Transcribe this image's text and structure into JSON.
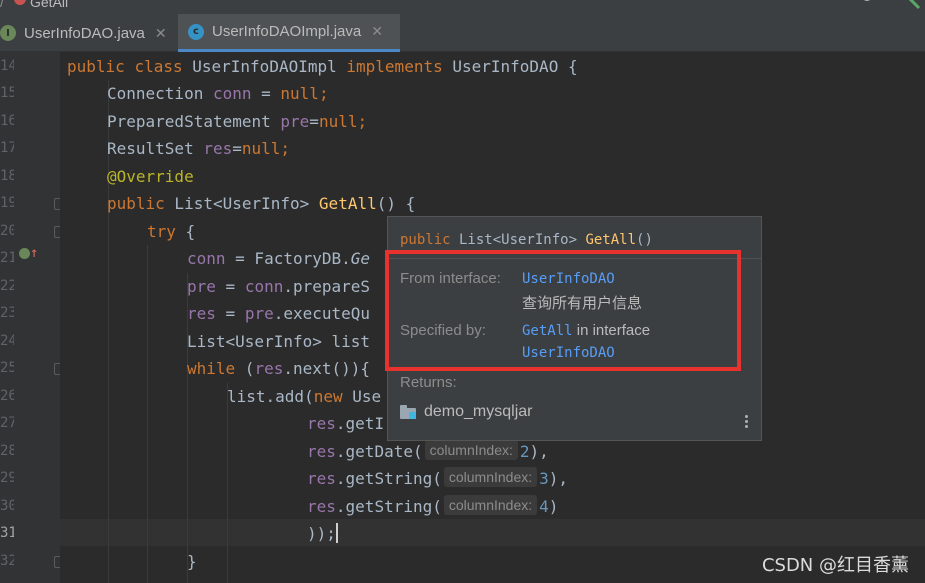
{
  "breadcrumb": {
    "method": "GetAll"
  },
  "tabs": [
    {
      "name": "UserInfoDAO.java",
      "icon": "I",
      "icon_color": "#6a8759",
      "active": false
    },
    {
      "name": "UserInfoDAOImpl.java",
      "icon": "c",
      "icon_color": "#3592c4",
      "active": true
    }
  ],
  "gutter": {
    "line_numbers": [
      "14",
      "15",
      "16",
      "17",
      "18",
      "19",
      "20",
      "21",
      "22",
      "23",
      "24",
      "25",
      "26",
      "27",
      "28",
      "29",
      "30",
      "31",
      "32"
    ]
  },
  "code": {
    "l14": {
      "kw1": "public",
      "kw2": "class",
      "name": "UserInfoDAOImpl",
      "kw3": "implements",
      "iface": "UserInfoDAO",
      "tail": " {"
    },
    "l15": {
      "type": "Connection ",
      "field": "conn",
      "mid": " = ",
      "kw": "null",
      "tail": ";"
    },
    "l16": {
      "type": "PreparedStatement ",
      "field": "pre",
      "mid": "=",
      "kw": "null",
      "tail": ";"
    },
    "l17": {
      "type": "ResultSet ",
      "field": "res",
      "mid": "=",
      "kw": "null",
      "tail": ";"
    },
    "l18": {
      "ann": "@Override"
    },
    "l19": {
      "kw": "public",
      "type": " List<UserInfo> ",
      "fn": "GetAll",
      "tail": "() {"
    },
    "l20": {
      "kw": "try",
      "tail": " {"
    },
    "l21": {
      "field": "conn",
      "mid": " = FactoryDB.",
      "call": "Ge"
    },
    "l22": {
      "field": "pre",
      "mid": " = ",
      "field2": "conn",
      "call": ".prepareS",
      "end": ";"
    },
    "l23": {
      "field": "res",
      "mid": " = ",
      "field2": "pre",
      "call": ".executeQu"
    },
    "l24": {
      "text": "List<UserInfo> list"
    },
    "l25": {
      "kw": "while",
      "mid": " (",
      "field": "res",
      "call": ".next()){"
    },
    "l26": {
      "text": "list.add(",
      "kw": "new",
      "tail": " Use"
    },
    "l27": {
      "field": "res",
      "call": ".getI"
    },
    "l28": {
      "field": "res",
      "call": ".getDate(",
      "hint": "columnIndex:",
      "num": "2",
      "tail": "),"
    },
    "l29": {
      "field": "res",
      "call": ".getString(",
      "hint": "columnIndex:",
      "num": "3",
      "tail": "),"
    },
    "l30": {
      "field": "res",
      "call": ".getString(",
      "hint": "columnIndex:",
      "num": "4",
      "tail": ")"
    },
    "l31": {
      "text": "));"
    },
    "l32": {
      "text": "}"
    }
  },
  "popup": {
    "sig_kw": "public",
    "sig_type": " List<UserInfo> ",
    "sig_fn": "GetAll",
    "sig_tail": "()",
    "from_label": "From interface:",
    "from_link": "UserInfoDAO",
    "from_desc": "查询所有用户信息",
    "spec_label": "Specified by:",
    "spec_link1": "GetAll",
    "spec_mid": " in interface",
    "spec_link2": "UserInfoDAO",
    "returns_label": "Returns:",
    "module": "demo_mysqljar"
  },
  "watermark": "CSDN @红目香薰",
  "colors": {
    "highlight": "#e8322e",
    "keyword": "#cc7832",
    "field": "#9876aa",
    "method": "#ffc66d",
    "link": "#589df6"
  }
}
